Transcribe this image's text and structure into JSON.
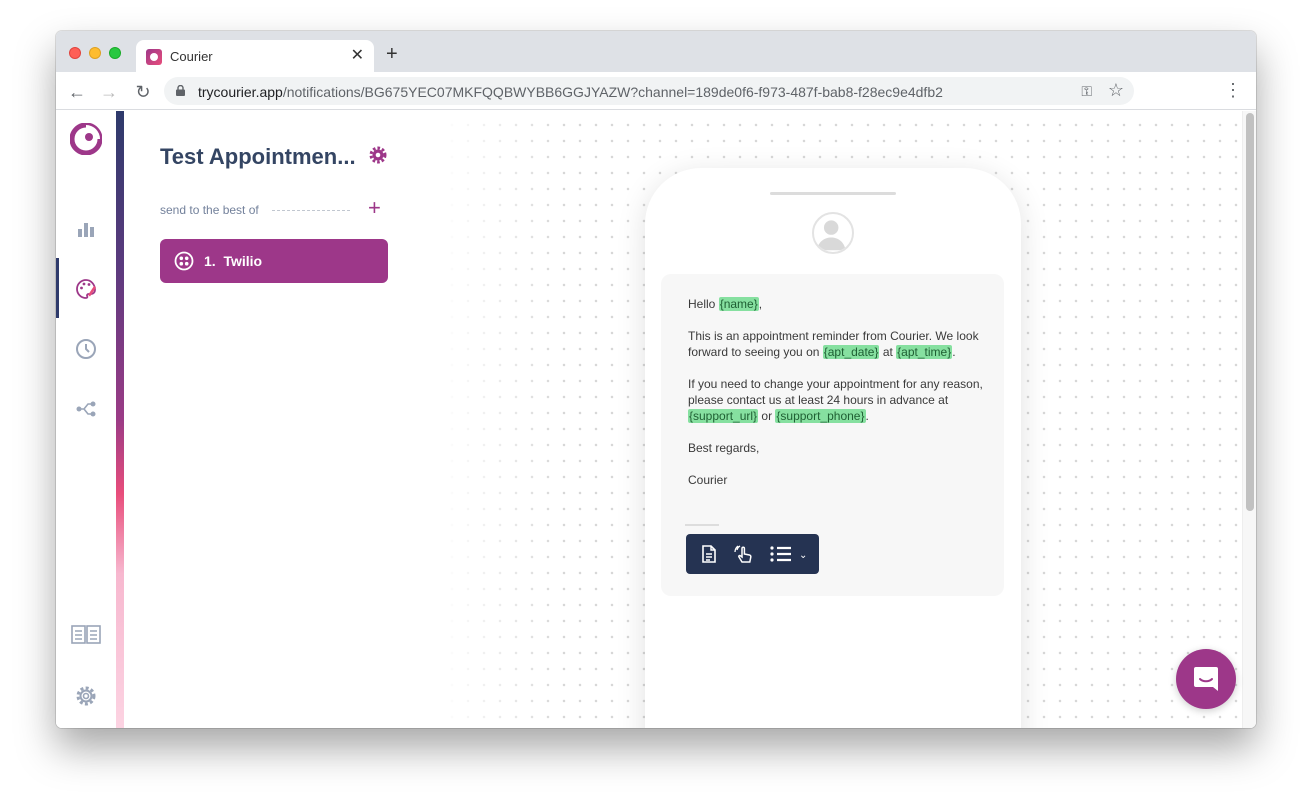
{
  "browser": {
    "tab_title": "Courier",
    "url_host": "trycourier.app",
    "url_path": "/notifications/BG675YEC07MKFQQBWYBB6GGJYAZW?channel=189de0f6-f973-487f-bab8-f28ec9e4dfb2"
  },
  "sidebar": {
    "items": [
      {
        "name": "analytics",
        "icon": "bar-chart-icon"
      },
      {
        "name": "designer",
        "icon": "palette-icon",
        "active": true
      },
      {
        "name": "history",
        "icon": "clock-icon"
      },
      {
        "name": "integrations",
        "icon": "share-icon"
      }
    ],
    "bottom_items": [
      {
        "name": "docs",
        "icon": "book-icon"
      },
      {
        "name": "settings",
        "icon": "gear-icon"
      }
    ]
  },
  "panel": {
    "title": "Test Appointmen...",
    "strategy_label": "send to the best of",
    "channels": [
      {
        "index": "1.",
        "label": "Twilio",
        "icon": "twilio-icon"
      }
    ]
  },
  "message": {
    "greeting_prefix": "Hello ",
    "var_name": "{name}",
    "greeting_suffix": ",",
    "p2_text1": "This is an appointment reminder from Courier. We look forward to seeing you on ",
    "var_apt_date": "{apt_date}",
    "p2_text2": " at ",
    "var_apt_time": "{apt_time}",
    "p2_text3": ".",
    "p3_text1": "If you need to change your appointment for any reason, please contact us at least 24 hours in advance at ",
    "var_support_url": "{support_url}",
    "p3_text2": " or ",
    "var_support_phone": "{support_phone}",
    "p3_text3": ".",
    "sign_off": "Best regards,",
    "signature": "Courier"
  },
  "colors": {
    "brand": "#9d3789",
    "toolbar": "#253352",
    "variable_highlight": "#86e0a0"
  }
}
